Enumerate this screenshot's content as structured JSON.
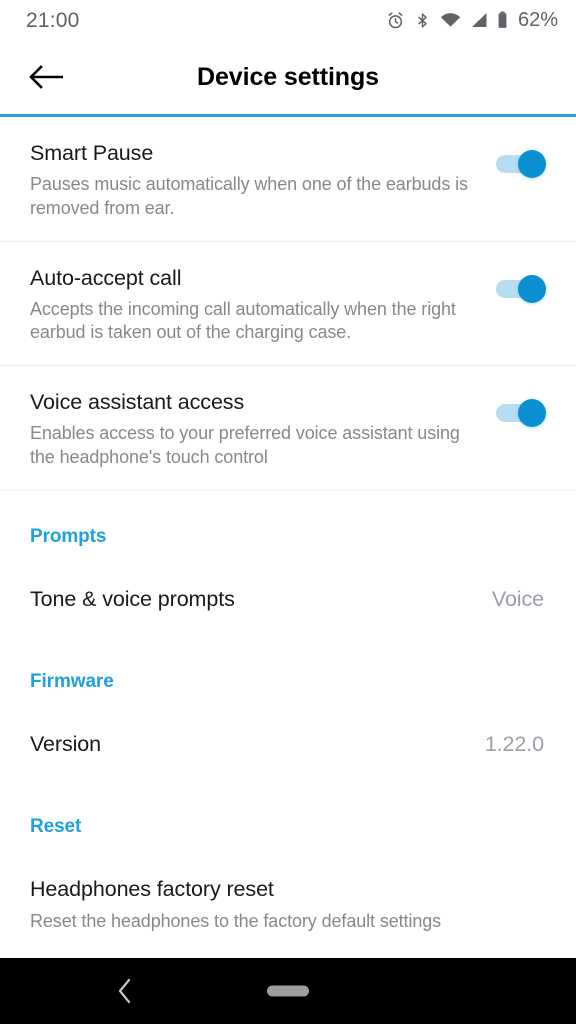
{
  "status_bar": {
    "clock": "21:00",
    "battery_percent": "62%",
    "icons": [
      "alarm-icon",
      "bluetooth-icon",
      "wifi-icon",
      "cellular-signal-icon",
      "battery-icon"
    ]
  },
  "app_bar": {
    "back_icon": "back-arrow-icon",
    "title": "Device settings",
    "accent_color": "#1FA0E0"
  },
  "settings": {
    "toggles": [
      {
        "title": "Smart Pause",
        "description": "Pauses music automatically when one of the earbuds is removed from ear.",
        "state": "on"
      },
      {
        "title": "Auto-accept call",
        "description": "Accepts the incoming call automatically when the right earbud is taken out of the charging case.",
        "state": "on"
      },
      {
        "title": "Voice assistant access",
        "description": "Enables access to your preferred voice assistant using the headphone's touch control",
        "state": "on"
      }
    ],
    "sections": [
      {
        "header": "Prompts",
        "item_title": "Tone & voice prompts",
        "item_value": "Voice"
      },
      {
        "header": "Firmware",
        "item_title": "Version",
        "item_value": "1.22.0"
      },
      {
        "header": "Reset",
        "item_title": "Headphones factory reset",
        "item_description": "Reset the headphones to the factory default settings"
      }
    ]
  },
  "nav_bar": {
    "back_icon": "nav-back-chevron-icon",
    "home_icon": "nav-home-pill-icon"
  }
}
